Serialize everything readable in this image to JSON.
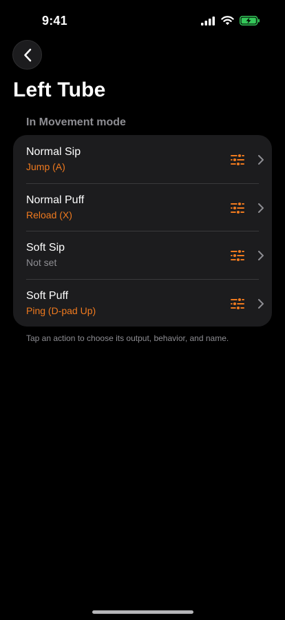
{
  "status_bar": {
    "time": "9:41",
    "icons": [
      "cellular-signal-icon",
      "wifi-icon",
      "battery-charging-icon"
    ],
    "battery_color": "#34c759"
  },
  "header": {
    "back_icon": "chevron-left-icon",
    "title": "Left Tube"
  },
  "section": {
    "header": "In Movement mode",
    "rows": [
      {
        "title": "Normal Sip",
        "subtitle": "Jump (A)",
        "set": true
      },
      {
        "title": "Normal Puff",
        "subtitle": "Reload (X)",
        "set": true
      },
      {
        "title": "Soft Sip",
        "subtitle": "Not set",
        "set": false
      },
      {
        "title": "Soft Puff",
        "subtitle": "Ping (D-pad Up)",
        "set": true
      }
    ],
    "row_icons": [
      "sliders-icon",
      "chevron-right-icon"
    ],
    "footer": "Tap an action to choose its output, behavior, and name."
  },
  "colors": {
    "accent": "#f07a1e",
    "secondary_text": "#8e8e93",
    "card_background": "#1c1c1e",
    "separator": "#3a3a3c"
  }
}
